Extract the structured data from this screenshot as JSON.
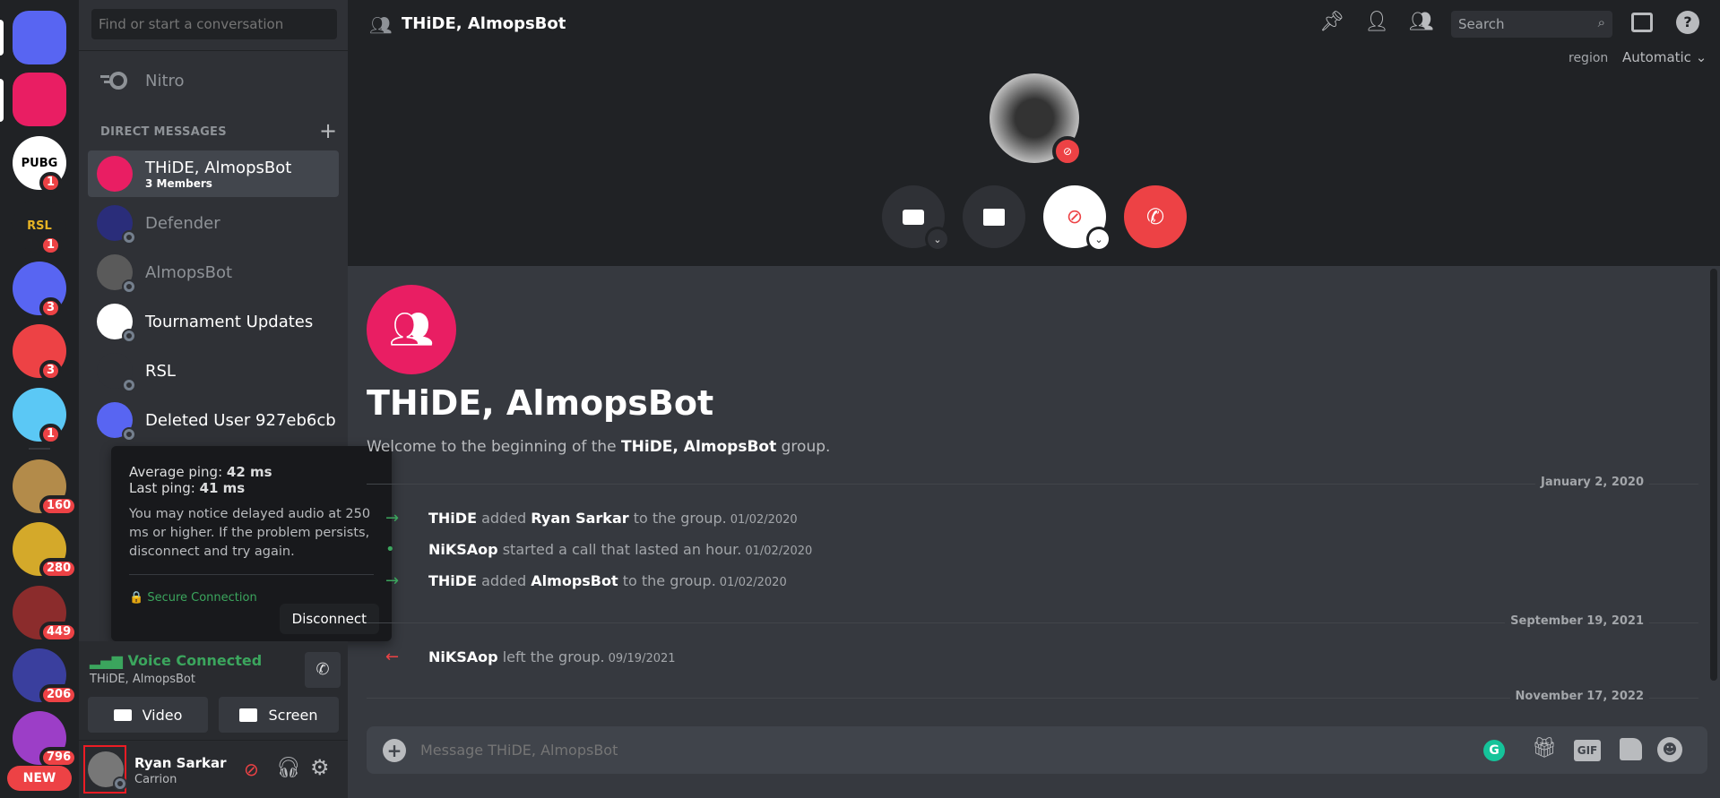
{
  "servers": [
    {
      "name": "home",
      "color": "#5865f2",
      "badge": null
    },
    {
      "name": "group-call",
      "color": "#e91e63",
      "badge": null
    },
    {
      "name": "pubg",
      "color": "#ffffff",
      "badge": "1",
      "label": "PUBG"
    },
    {
      "name": "rsl",
      "color": "#202225",
      "badge": "1",
      "label": "RSL"
    },
    {
      "name": "discord-blue",
      "color": "#5865f2",
      "badge": "3"
    },
    {
      "name": "discord-red",
      "color": "#ed4245",
      "badge": "3"
    },
    {
      "name": "smiley",
      "color": "#5bc8f5",
      "badge": "1"
    },
    {
      "name": "server-a",
      "color": "#b38b4a",
      "badge": "160"
    },
    {
      "name": "server-b",
      "color": "#d4a92a",
      "badge": "280"
    },
    {
      "name": "server-c",
      "color": "#8b2c2c",
      "badge": "449"
    },
    {
      "name": "server-d",
      "color": "#3a3f9e",
      "badge": "206"
    },
    {
      "name": "server-e",
      "color": "#9c3ec7",
      "badge": "796"
    }
  ],
  "new_label": "NEW",
  "dm": {
    "search_placeholder": "Find or start a conversation",
    "nitro": "Nitro",
    "section": "DIRECT MESSAGES",
    "items": [
      {
        "name": "THiDE, AlmopsBot",
        "sub": "3 Members",
        "color": "#e91e63"
      },
      {
        "name": "Defender",
        "color": "#2a2d7a"
      },
      {
        "name": "AlmopsBot",
        "color": "#5a5a5a"
      },
      {
        "name": "Tournament Updates",
        "color": "#ffffff"
      },
      {
        "name": "RSL",
        "color": "#2f3136"
      },
      {
        "name": "Deleted User 927eb6cb",
        "color": "#5865f2"
      }
    ]
  },
  "tooltip": {
    "avg_label": "Average ping:",
    "avg": "42 ms",
    "last_label": "Last ping:",
    "last": "41 ms",
    "body": "You may notice delayed audio at 250 ms or higher. If the problem persists, disconnect and try again.",
    "secure": "Secure Connection",
    "disconnect": "Disconnect"
  },
  "voice": {
    "status": "Voice Connected",
    "channel": "THiDE, AlmopsBot",
    "video": "Video",
    "screen": "Screen"
  },
  "user": {
    "name": "Ryan Sarkar",
    "status": "Carrion"
  },
  "header": {
    "title": "THiDE, AlmopsBot",
    "search": "Search",
    "region_label": "region",
    "region_value": "Automatic"
  },
  "chat": {
    "title": "THiDE, AlmopsBot",
    "welcome_pre": "Welcome to the beginning of the ",
    "welcome_bold": "THiDE, AlmopsBot",
    "welcome_post": " group.",
    "dates": [
      "January 2, 2020",
      "September 19, 2021",
      "November 17, 2022"
    ],
    "messages": [
      {
        "a": "THiDE",
        "t": " added ",
        "b": "Ryan Sarkar",
        "e": " to the group.",
        "ts": "01/02/2020",
        "kind": "join"
      },
      {
        "a": "NiKSAop",
        "t": " started a call that lasted an hour.",
        "b": "",
        "e": "",
        "ts": "01/02/2020",
        "kind": "call"
      },
      {
        "a": "THiDE",
        "t": " added ",
        "b": "AlmopsBot",
        "e": " to the group.",
        "ts": "01/02/2020",
        "kind": "join"
      },
      {
        "a": "NiKSAop",
        "t": " left the group.",
        "b": "",
        "e": "",
        "ts": "09/19/2021",
        "kind": "leave"
      }
    ],
    "input_placeholder": "Message THiDE, AlmopsBot",
    "gif": "GIF"
  },
  "colors": {
    "accent": "#5865f2",
    "danger": "#ed4245",
    "green": "#3ba55d",
    "group": "#e91e63"
  }
}
